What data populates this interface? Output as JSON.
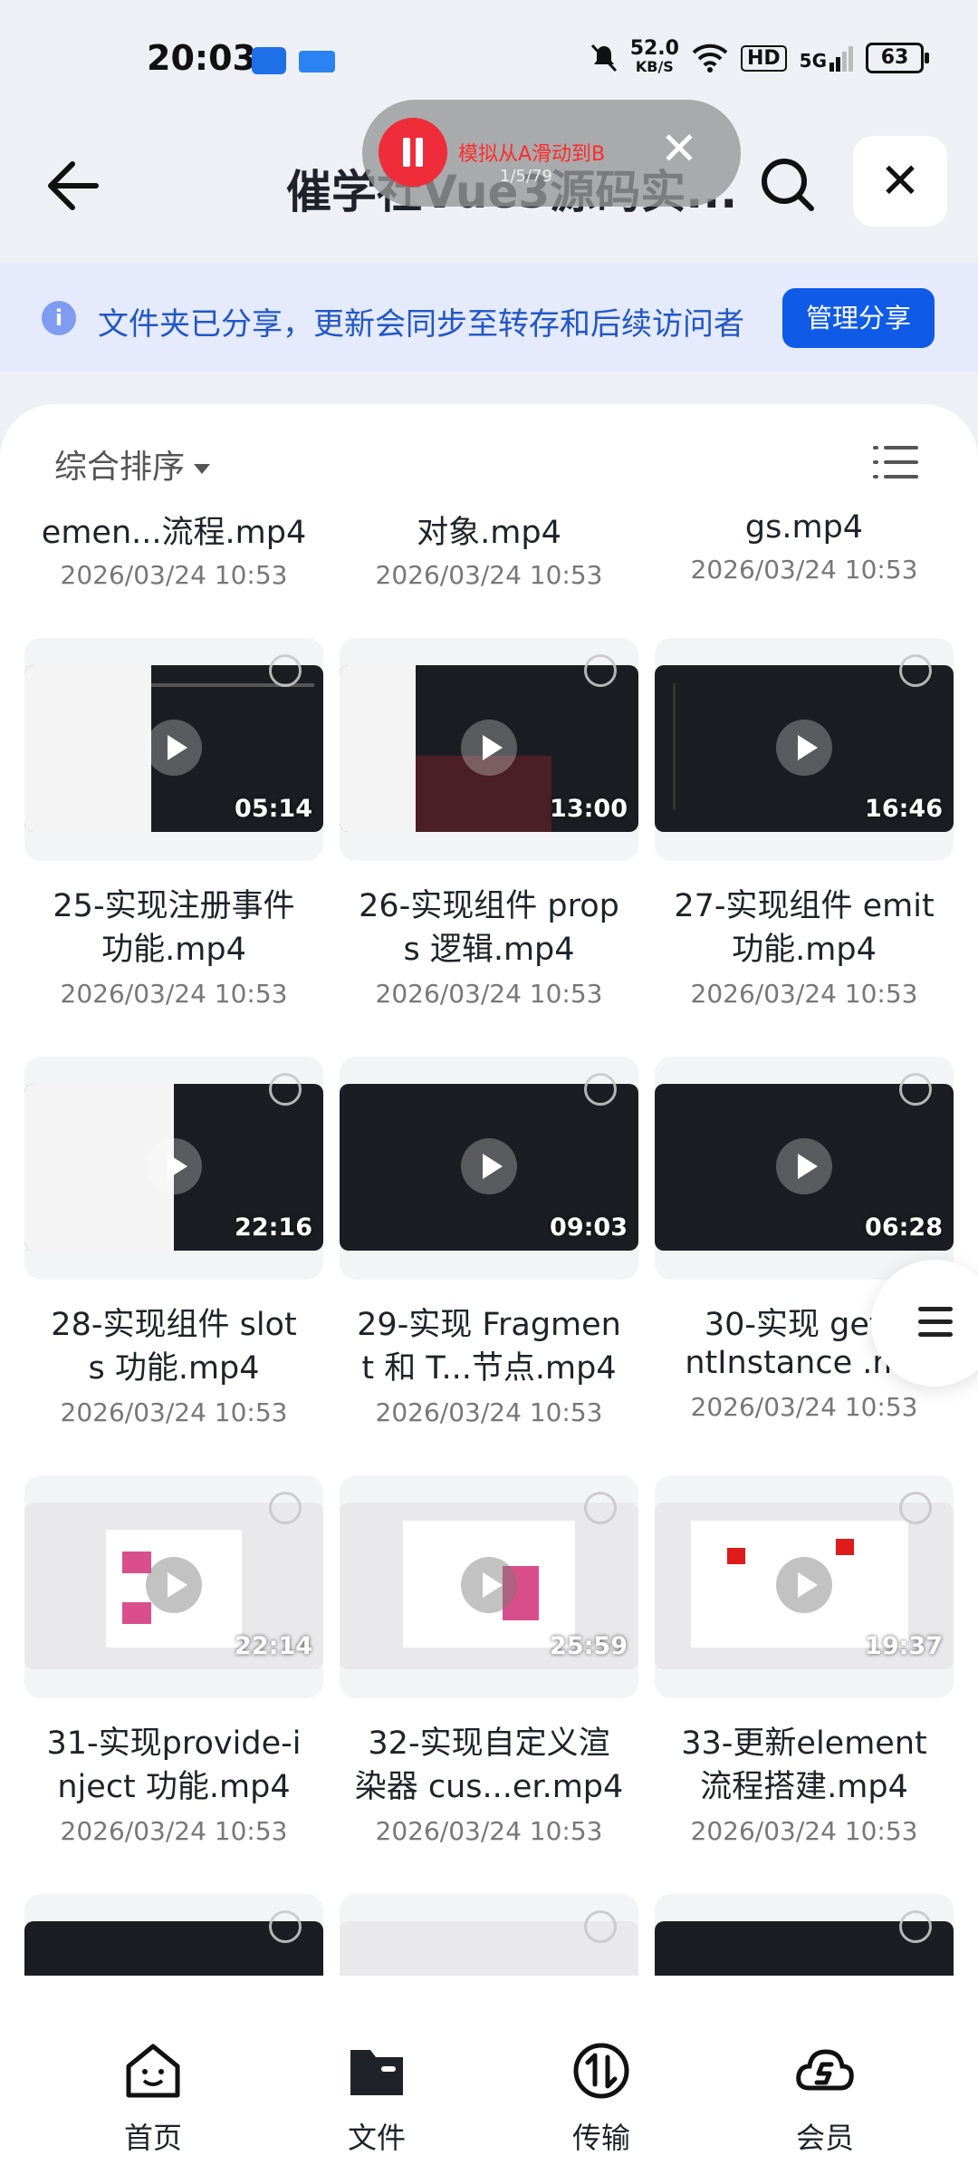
{
  "status_bar": {
    "time": "20:03",
    "speed_value": "52.0",
    "speed_unit": "KB/S",
    "hd": "HD",
    "network": "5G",
    "battery": "63"
  },
  "header": {
    "title": "催学社Vue3源码实...",
    "overlay_text": "模拟从A滑动到B",
    "overlay_count": "1/5/79"
  },
  "banner": {
    "text": "文件夹已分享，更新会同步至转存和后续访问者",
    "manage_label": "管理分享"
  },
  "sort": {
    "label": "综合排序"
  },
  "partial_row": [
    {
      "name": "emen...流程.mp4",
      "date": "2026/03/24 10:53"
    },
    {
      "name": "对象.mp4",
      "date": "2026/03/24 10:53"
    },
    {
      "name": "gs.mp4",
      "date": "2026/03/24 10:53"
    }
  ],
  "files": [
    {
      "line1": "25-实现注册事件",
      "line2": "功能.mp4",
      "date": "2026/03/24 10:53",
      "duration": "05:14"
    },
    {
      "line1": "26-实现组件 prop",
      "line2": "s 逻辑.mp4",
      "date": "2026/03/24 10:53",
      "duration": "13:00"
    },
    {
      "line1": "27-实现组件 emit",
      "line2": "功能.mp4",
      "date": "2026/03/24 10:53",
      "duration": "16:46"
    },
    {
      "line1": "28-实现组件 slot",
      "line2": "s 功能.mp4",
      "date": "2026/03/24 10:53",
      "duration": "22:16"
    },
    {
      "line1": "29-实现 Fragmen",
      "line2": "t 和 T...节点.mp4",
      "date": "2026/03/24 10:53",
      "duration": "09:03"
    },
    {
      "line1": "30-实现 getC",
      "line2": "ntInstance .mp",
      "date": "2026/03/24 10:53",
      "duration": "06:28"
    },
    {
      "line1": "31-实现provide-i",
      "line2": "nject 功能.mp4",
      "date": "2026/03/24 10:53",
      "duration": "22:14"
    },
    {
      "line1": "32-实现自定义渲",
      "line2": "染器 cus...er.mp4",
      "date": "2026/03/24 10:53",
      "duration": "25:59"
    },
    {
      "line1": "33-更新element",
      "line2": "流程搭建.mp4",
      "date": "2026/03/24 10:53",
      "duration": "19:37"
    }
  ],
  "nav": [
    {
      "label": "首页",
      "icon": "home-icon"
    },
    {
      "label": "文件",
      "icon": "folder-icon"
    },
    {
      "label": "传输",
      "icon": "transfer-icon"
    },
    {
      "label": "会员",
      "icon": "vip-icon"
    }
  ]
}
